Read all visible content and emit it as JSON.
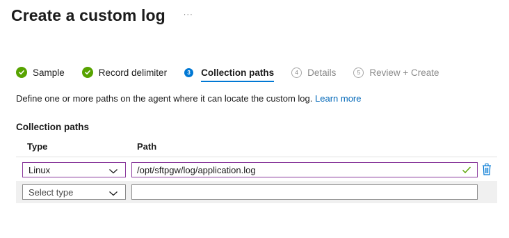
{
  "header": {
    "title": "Create a custom log",
    "more_label": "···"
  },
  "wizard": {
    "steps": [
      {
        "label": "Sample",
        "status": "complete",
        "icon": "check-circle-icon"
      },
      {
        "label": "Record delimiter",
        "status": "complete",
        "icon": "check-circle-icon"
      },
      {
        "label": "Collection paths",
        "status": "current",
        "number": "3"
      },
      {
        "label": "Details",
        "status": "pending",
        "number": "4"
      },
      {
        "label": "Review + Create",
        "status": "pending",
        "number": "5"
      }
    ]
  },
  "description": {
    "text": "Define one or more paths on the agent where it can locate the custom log.",
    "link": "Learn more"
  },
  "collection_paths": {
    "section_label": "Collection paths",
    "columns": {
      "type": "Type",
      "path": "Path"
    },
    "rows": [
      {
        "type_value": "Linux",
        "path_value": "/opt/sftpgw/log/application.log",
        "valid": true
      },
      {
        "type_placeholder": "Select type",
        "path_value": ""
      }
    ]
  },
  "colors": {
    "accent": "#0078d4",
    "success": "#57a300",
    "focus_border": "#8a3a9c",
    "link": "#0067b8"
  }
}
